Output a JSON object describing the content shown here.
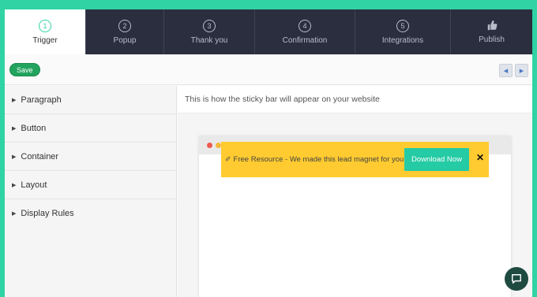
{
  "tabs": [
    {
      "num": "1",
      "label": "Trigger",
      "active": true
    },
    {
      "num": "2",
      "label": "Popup"
    },
    {
      "num": "3",
      "label": "Thank you"
    },
    {
      "num": "4",
      "label": "Confirmation"
    },
    {
      "num": "5",
      "label": "Integrations"
    },
    {
      "icon": "thumbs-up-icon",
      "label": "Publish"
    }
  ],
  "toolbar": {
    "save_label": "Save",
    "prev_glyph": "◀",
    "next_glyph": "▶"
  },
  "sidebar": {
    "items": [
      {
        "label": "Paragraph"
      },
      {
        "label": "Button"
      },
      {
        "label": "Container"
      },
      {
        "label": "Layout"
      },
      {
        "label": "Display Rules"
      }
    ],
    "caret": "▶"
  },
  "preview": {
    "caption": "This is how the sticky bar will appear on your website",
    "sticky_text": "Free Resource - We made this lead magnet for you.",
    "pin_glyph": "✐",
    "button_label": "Download Now",
    "close_glyph": "✕"
  },
  "colors": {
    "accent": "#2fd3a4",
    "tab_bg": "#2b2e3e",
    "save": "#22a35e",
    "sticky_bar": "#ffcb30",
    "download_button": "#25cba4",
    "dot_red": "#ee5b4f",
    "dot_yellow": "#f4b93a",
    "dot_green": "#34c24a",
    "chat": "#1e4a40"
  }
}
